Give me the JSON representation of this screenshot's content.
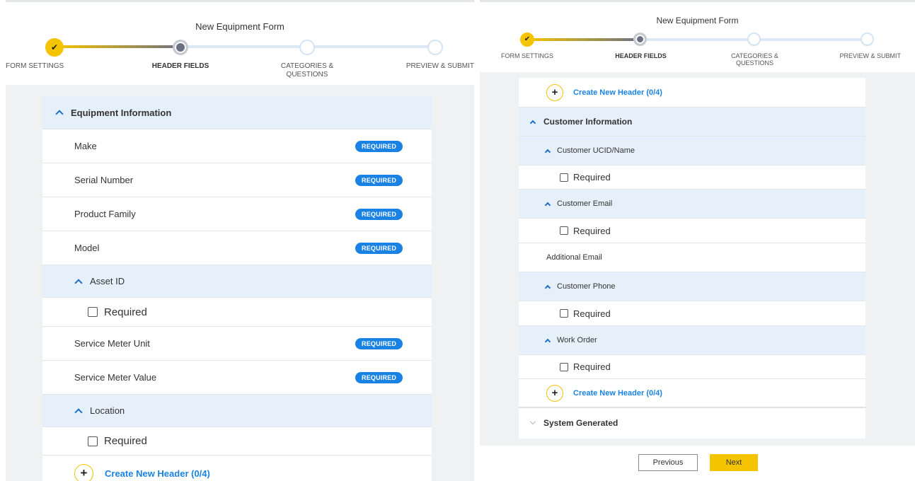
{
  "left": {
    "title": "New Equipment Form",
    "steps": [
      "FORM SETTINGS",
      "HEADER FIELDS",
      "CATEGORIES & QUESTIONS",
      "PREVIEW & SUBMIT"
    ],
    "section_title": "Equipment Information",
    "fields": [
      {
        "label": "Make",
        "badge": "REQUIRED"
      },
      {
        "label": "Serial Number",
        "badge": "REQUIRED"
      },
      {
        "label": "Product Family",
        "badge": "REQUIRED"
      },
      {
        "label": "Model",
        "badge": "REQUIRED"
      }
    ],
    "asset_id": {
      "label": "Asset ID",
      "required_label": "Required"
    },
    "fields2": [
      {
        "label": "Service Meter Unit",
        "badge": "REQUIRED"
      },
      {
        "label": "Service Meter Value",
        "badge": "REQUIRED"
      }
    ],
    "location": {
      "label": "Location",
      "required_label": "Required"
    },
    "create_header": "Create New Header (0/4)"
  },
  "right": {
    "title": "New Equipment Form",
    "steps": [
      "FORM SETTINGS",
      "HEADER FIELDS",
      "CATEGORIES & QUESTIONS",
      "PREVIEW & SUBMIT"
    ],
    "create_header_top": "Create New Header (0/4)",
    "section_title": "Customer Information",
    "customer_ucid": {
      "label": "Customer UCID/Name",
      "required_label": "Required"
    },
    "customer_email": {
      "label": "Customer Email",
      "required_label": "Required"
    },
    "additional_email": "Additional Email",
    "customer_phone": {
      "label": "Customer Phone",
      "required_label": "Required"
    },
    "work_order": {
      "label": "Work Order",
      "required_label": "Required"
    },
    "create_header_bottom": "Create New Header (0/4)",
    "system_generated": "System Generated",
    "previous": "Previous",
    "next": "Next"
  },
  "colors": {
    "accent_yellow": "#f5c400",
    "link_blue": "#1a82e2",
    "section_bg": "#e6f0fa"
  }
}
